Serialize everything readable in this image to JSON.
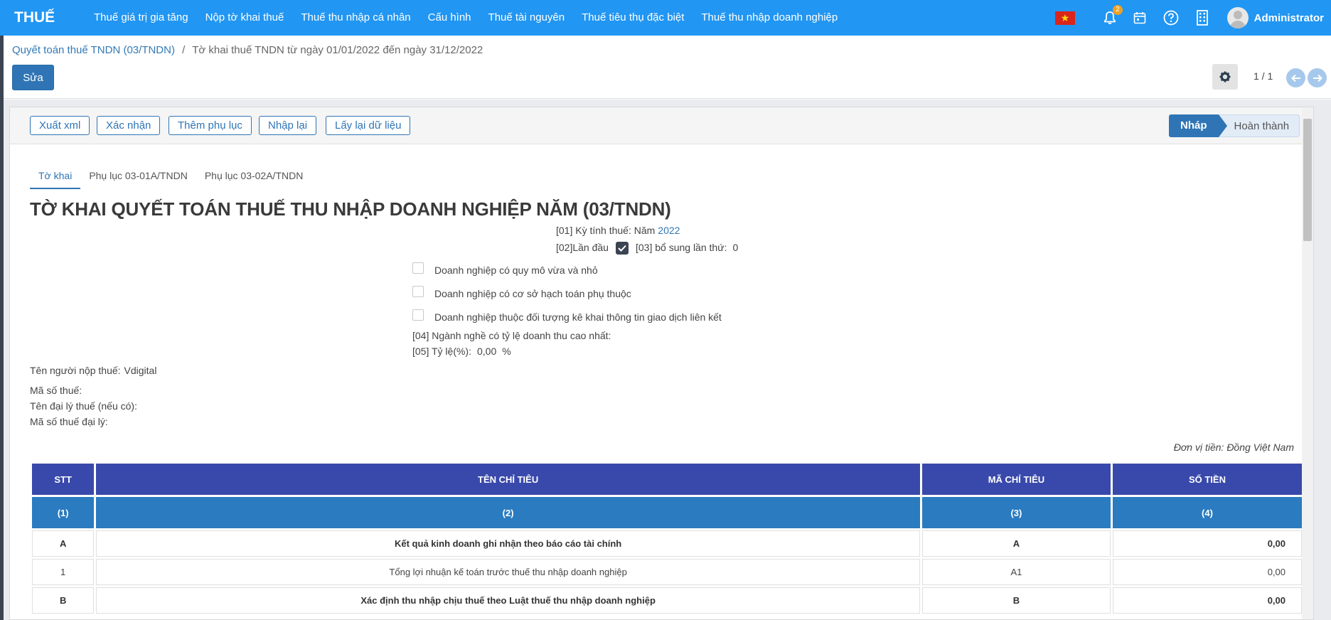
{
  "navbar": {
    "brand": "THUẾ",
    "menu": [
      "Thuế giá trị gia tăng",
      "Nộp tờ khai thuế",
      "Thuế thu nhập cá nhân",
      "Cấu hình",
      "Thuế tài nguyên",
      "Thuế tiêu thụ đặc biệt",
      "Thuế thu nhập doanh nghiệp"
    ],
    "notification_count": "2",
    "user_name": "Administrator"
  },
  "breadcrumb": {
    "parent": "Quyết toán thuế TNDN (03/TNDN)",
    "separator": "/",
    "current": "Tờ khai thuế TNDN từ ngày 01/01/2022 đến ngày 31/12/2022"
  },
  "control": {
    "edit_label": "Sửa",
    "pager": "1 / 1"
  },
  "statusbar": {
    "buttons": [
      "Xuất xml",
      "Xác nhận",
      "Thêm phụ lục",
      "Nhập lại",
      "Lấy lại dữ liệu"
    ],
    "state_active": "Nháp",
    "state_next": "Hoàn thành"
  },
  "tabs": [
    "Tờ khai",
    "Phụ lục 03-01A/TNDN",
    "Phụ lục 03-02A/TNDN"
  ],
  "form": {
    "title": "TỜ KHAI QUYẾT TOÁN THUẾ THU NHẬP DOANH NGHIỆP NĂM (03/TNDN)",
    "period_label": "[01] Kỳ tính thuế: Năm",
    "period_value": "2022",
    "first_label": "[02]Lần đầu",
    "first_checked": true,
    "supplement_label": "[03] bổ sung lần thứ:",
    "supplement_value": "0",
    "checkboxes": [
      "Doanh nghiệp có quy mô vừa và nhỏ",
      "Doanh nghiệp có cơ sở hạch toán phụ thuộc",
      "Doanh nghiệp thuộc đối tượng kê khai thông tin giao dịch liên kết"
    ],
    "industry_label": "[04] Ngành nghề có tỷ lệ doanh thu cao nhất:",
    "ratio_label": "[05] Tỷ lệ(%):",
    "ratio_value": "0,00",
    "ratio_unit": "%",
    "taxpayer_label": "Tên người nộp thuế:",
    "taxpayer_value": "Vdigital",
    "tax_code_label": "Mã số thuế:",
    "agent_name_label": "Tên đại lý thuế (nếu có):",
    "agent_code_label": "Mã số thuế đại lý:",
    "currency_note": "Đơn vị tiền: Đồng Việt Nam"
  },
  "table": {
    "headers": [
      "STT",
      "TÊN CHỈ TIÊU",
      "MÃ CHỈ TIÊU",
      "SỐ TIỀN"
    ],
    "subheaders": [
      "(1)",
      "(2)",
      "(3)",
      "(4)"
    ],
    "rows": [
      {
        "stt": "A",
        "name": "Kết quả kinh doanh ghi nhận theo báo cáo tài chính",
        "code": "A",
        "amount": "0,00",
        "bold": true
      },
      {
        "stt": "1",
        "name": "Tổng lợi nhuận kế toán trước thuế thu nhập doanh nghiệp",
        "code": "A1",
        "amount": "0,00",
        "bold": false
      },
      {
        "stt": "B",
        "name": "Xác định thu nhập chịu thuế theo Luật thuế thu nhập doanh nghiệp",
        "code": "B",
        "amount": "0,00",
        "bold": true
      }
    ]
  },
  "colors": {
    "navbar": "#2196f3",
    "primary": "#2f75b5",
    "table_header": "#3949ab",
    "table_subheader": "#2a7bc0"
  }
}
